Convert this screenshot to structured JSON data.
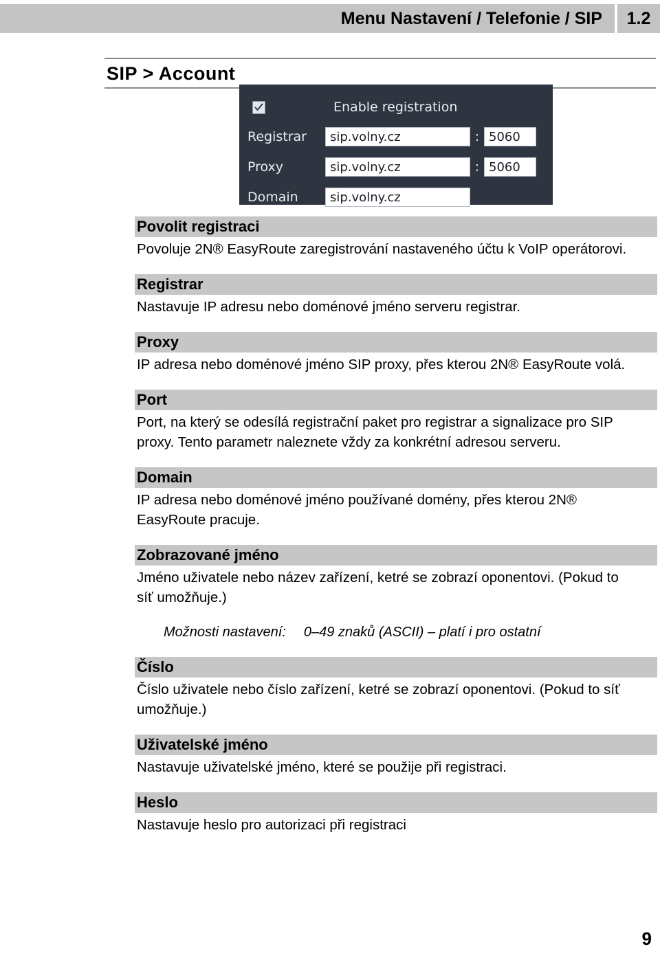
{
  "header": {
    "title": "Menu Nastavení / Telefonie / SIP",
    "version": "1.2"
  },
  "section": {
    "title": "SIP > Account"
  },
  "sip_dialog": {
    "enable_registration_label": "Enable registration",
    "enable_registration_checked": true,
    "checkbox_icon": "checkmark-icon",
    "separator": ":",
    "rows": [
      {
        "label": "Registrar",
        "host": "sip.volny.cz",
        "port": "5060"
      },
      {
        "label": "Proxy",
        "host": "sip.volny.cz",
        "port": "5060"
      },
      {
        "label": "Domain",
        "host": "sip.volny.cz",
        "port": ""
      }
    ],
    "panel_color": "#2e3541",
    "field_color": "#ffffff",
    "label_color": "#e9ecef"
  },
  "entries": [
    {
      "heading": "Povolit registraci",
      "body": "Povoluje 2N® EasyRoute zaregistrování nastaveného účtu k VoIP operátorovi."
    },
    {
      "heading": "Registrar",
      "body": "Nastavuje IP adresu nebo doménové jméno serveru registrar."
    },
    {
      "heading": "Proxy",
      "body": "IP adresa nebo doménové jméno SIP proxy, přes kterou 2N® EasyRoute volá."
    },
    {
      "heading": "Port",
      "body": "Port, na který se odesílá registrační paket pro registrar a signalizace pro SIP proxy. Tento parametr naleznete vždy za konkrétní adresou serveru."
    },
    {
      "heading": "Domain",
      "body": "IP adresa nebo doménové jméno používané domény, přes kterou 2N® EasyRoute pracuje."
    },
    {
      "heading": "Zobrazované jméno",
      "body": "Jméno uživatele nebo název zařízení, ketré se zobrazí oponentovi. (Pokud to síť umožňuje.)",
      "option_label": "Možnosti nastavení:",
      "option_value": "0–49 znaků (ASCII) – platí i pro ostatní"
    },
    {
      "heading": "Číslo",
      "body": "Číslo uživatele nebo číslo zařízení, ketré se zobrazí oponentovi. (Pokud to síť umožňuje.)"
    },
    {
      "heading": "Uživatelské jméno",
      "body": "Nastavuje uživatelské jméno, které se použije při registraci."
    },
    {
      "heading": "Heslo",
      "body": "Nastavuje heslo pro autorizaci při registraci"
    }
  ],
  "footer": {
    "page_number": "9"
  },
  "colors": {
    "header_band": "#c4c4c4",
    "heading_band": "#c6c6c6",
    "rule": "#8a8a8a"
  }
}
